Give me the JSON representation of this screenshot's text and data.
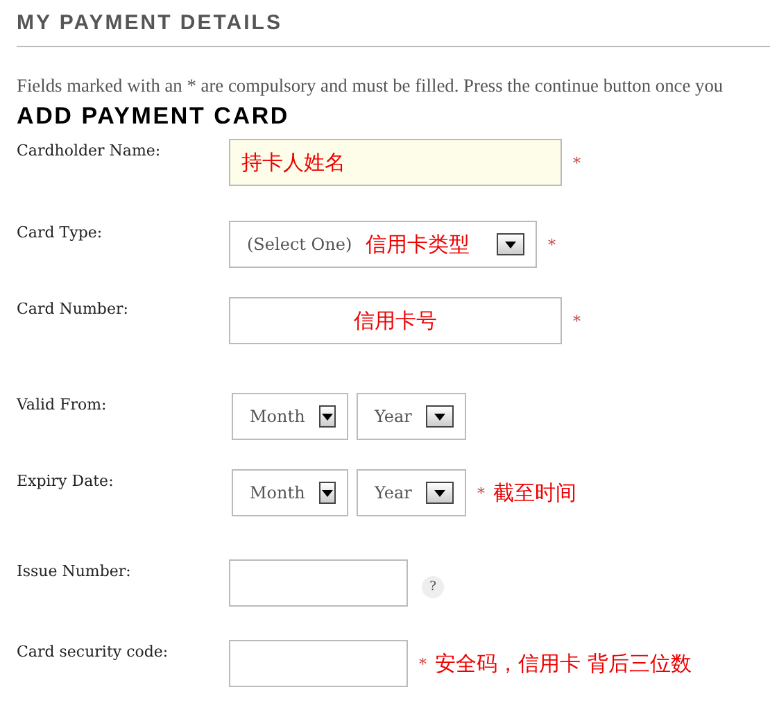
{
  "page_title": "MY PAYMENT DETAILS",
  "intro": "Fields marked with an * are compulsory and must be filled. Press the continue button once you",
  "section_title": "ADD PAYMENT CARD",
  "rows": [
    {
      "label": "Cardholder Name:",
      "kind": "text",
      "value": "持卡人姓名",
      "highlighted": true,
      "required": true
    },
    {
      "label": "Card Type:",
      "kind": "select",
      "value": "(Select One)",
      "inner_note": "信用卡类型",
      "required": true
    },
    {
      "label": "Card Number:",
      "kind": "text",
      "value": "信用卡号",
      "highlighted": false,
      "required": true
    },
    {
      "label": "Valid From:",
      "kind": "date",
      "selects": [
        "Month",
        "Year"
      ],
      "required": false
    },
    {
      "label": "Expiry Date:",
      "kind": "date",
      "selects": [
        "Month",
        "Year"
      ],
      "required": true,
      "note": "截至时间"
    },
    {
      "label": "Issue Number:",
      "kind": "text",
      "highlighted": false,
      "required": false,
      "help": "?"
    },
    {
      "label": "Card security code:",
      "kind": "text",
      "highlighted": false,
      "required": true,
      "note": "安全码，信用卡 背后三位数"
    }
  ],
  "required_mark": "*"
}
